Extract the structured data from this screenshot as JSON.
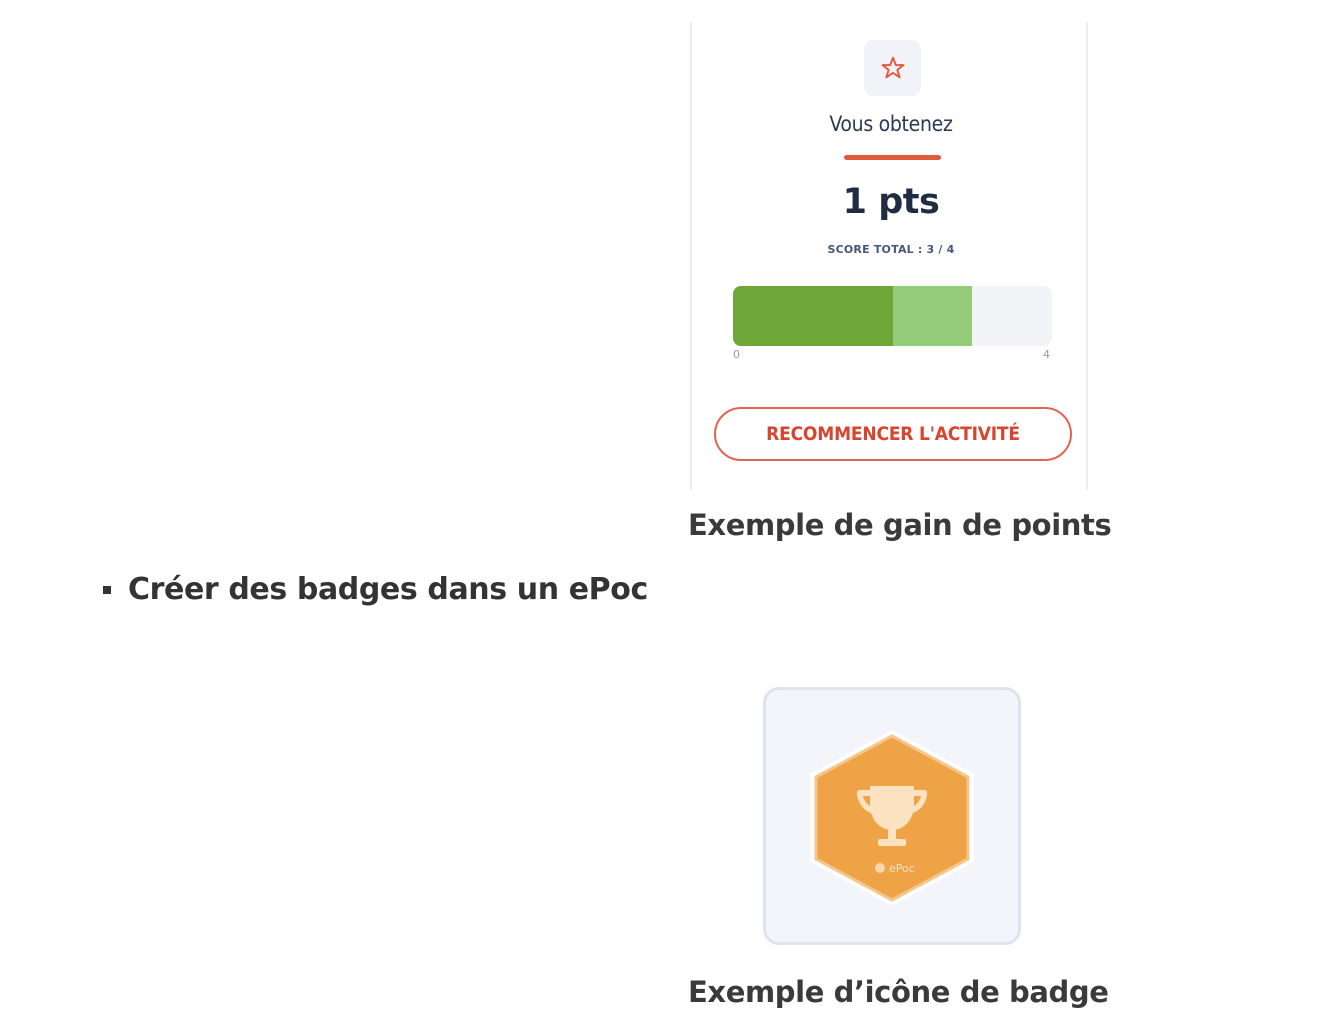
{
  "score_card": {
    "icon": "star-outline-icon",
    "gain_label": "Vous obtenez",
    "points_text": "1 pts",
    "score_total_text": "SCORE TOTAL : 3 / 4",
    "progress": {
      "min_label": "0",
      "max_label": "4",
      "min": 0,
      "max": 4,
      "previous_score": 2,
      "total_score": 3
    },
    "restart_button_label": "RECOMMENCER L'ACTIVITÉ",
    "colors": {
      "accent": "#e05a3e",
      "progress_dark": "#6ea638",
      "progress_light": "#94cc7a",
      "track": "#f3f4f8"
    }
  },
  "caption_points": "Exemple de gain de points",
  "bullet": {
    "text": "Créer des badges dans un ePoc"
  },
  "badge": {
    "icon": "trophy-icon",
    "label": "ePoc",
    "colors": {
      "hexagon": "#efa347",
      "frame": "#f3f5fa"
    }
  },
  "caption_badge": "Exemple d’icône de badge"
}
